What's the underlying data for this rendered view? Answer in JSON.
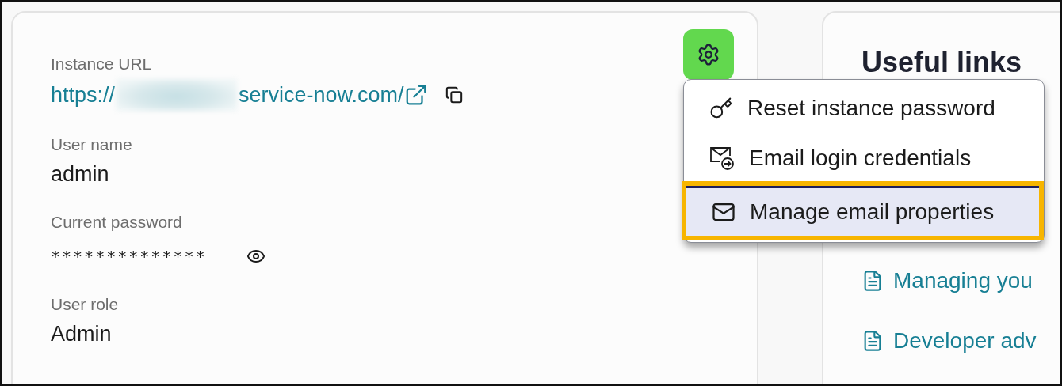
{
  "instance_card": {
    "settings_button": {
      "expanded": true
    },
    "fields": [
      {
        "kind": "url",
        "label": "Instance URL",
        "prefix": "https://",
        "redacted": true,
        "suffix": "service-now.com/"
      },
      {
        "kind": "text",
        "label": "User name",
        "value": "admin"
      },
      {
        "kind": "password",
        "label": "Current password",
        "value": "**************"
      },
      {
        "kind": "text",
        "label": "User role",
        "value": "Admin"
      }
    ]
  },
  "settings_menu": {
    "items": [
      {
        "kind": "key",
        "label": "Reset instance password",
        "selected": false
      },
      {
        "kind": "send",
        "label": "Email login credentials",
        "selected": false
      },
      {
        "kind": "mail",
        "label": "Manage email properties",
        "selected": true
      }
    ]
  },
  "useful_links": {
    "title": "Useful links",
    "links": [
      "Managing you",
      "Developer adv"
    ]
  }
}
